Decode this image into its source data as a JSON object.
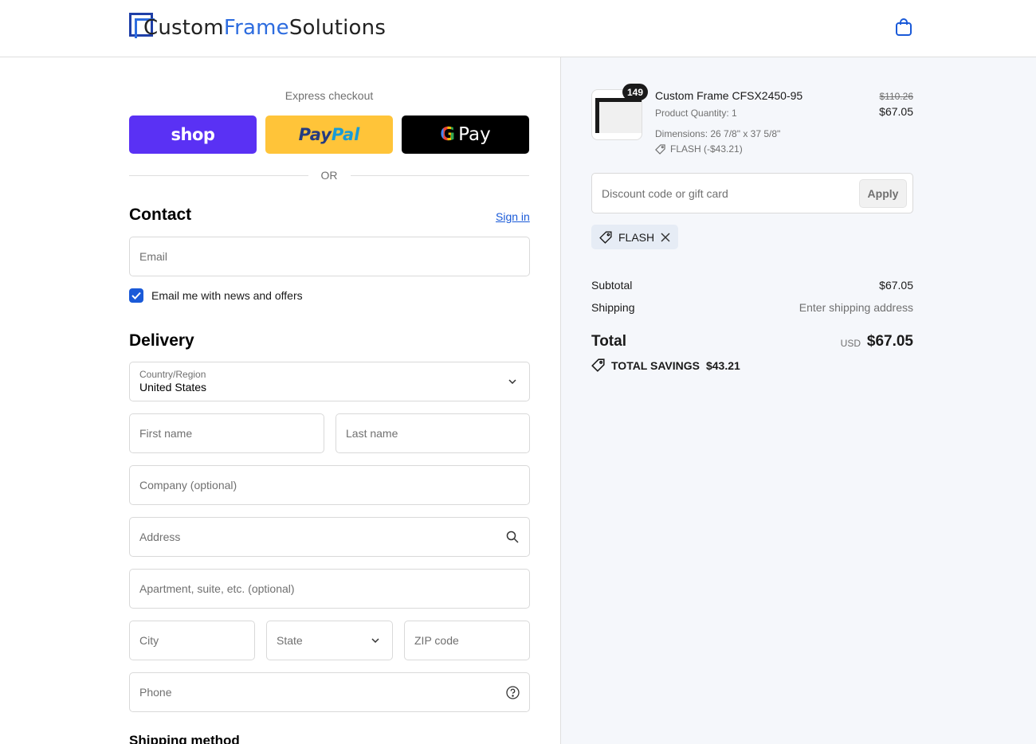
{
  "header": {
    "logo_part1": "Custom",
    "logo_part2": "Frame",
    "logo_part3": "Solutions",
    "cart_icon": "shopping-bag-icon"
  },
  "express": {
    "label": "Express checkout",
    "shop_label": "shop",
    "paypal_part1": "Pay",
    "paypal_part2": "Pal",
    "gpay_g": "G",
    "gpay_label": "Pay",
    "or_label": "OR"
  },
  "contact": {
    "title": "Contact",
    "signin": "Sign in",
    "email_placeholder": "Email",
    "newsletter_label": "Email me with news and offers",
    "newsletter_checked": true
  },
  "delivery": {
    "title": "Delivery",
    "country_label": "Country/Region",
    "country_value": "United States",
    "first_name": "First name",
    "last_name": "Last name",
    "company": "Company (optional)",
    "address": "Address",
    "apartment": "Apartment, suite, etc. (optional)",
    "city": "City",
    "state": "State",
    "zip": "ZIP code",
    "phone": "Phone"
  },
  "shipping_method": {
    "title": "Shipping method"
  },
  "order": {
    "badge_qty": "149",
    "product_name": "Custom Frame CFSX2450-95",
    "product_qty": "Product Quantity: 1",
    "dimensions": "Dimensions: 26 7/8\" x 37 5/8\"",
    "discount_line": "FLASH (-$43.21)",
    "price_original": "$110.26",
    "price_current": "$67.05"
  },
  "discount": {
    "placeholder": "Discount code or gift card",
    "apply_label": "Apply",
    "applied_code": "FLASH"
  },
  "summary": {
    "subtotal_label": "Subtotal",
    "subtotal_value": "$67.05",
    "shipping_label": "Shipping",
    "shipping_value": "Enter shipping address",
    "total_label": "Total",
    "currency": "USD",
    "total_value": "$67.05",
    "savings_label": "TOTAL SAVINGS",
    "savings_value": "$43.21"
  },
  "colors": {
    "accent": "#1a5ad8",
    "shop_purple": "#5a31f4",
    "paypal_yellow": "#ffc439",
    "panel_bg": "#f5f7fb"
  }
}
